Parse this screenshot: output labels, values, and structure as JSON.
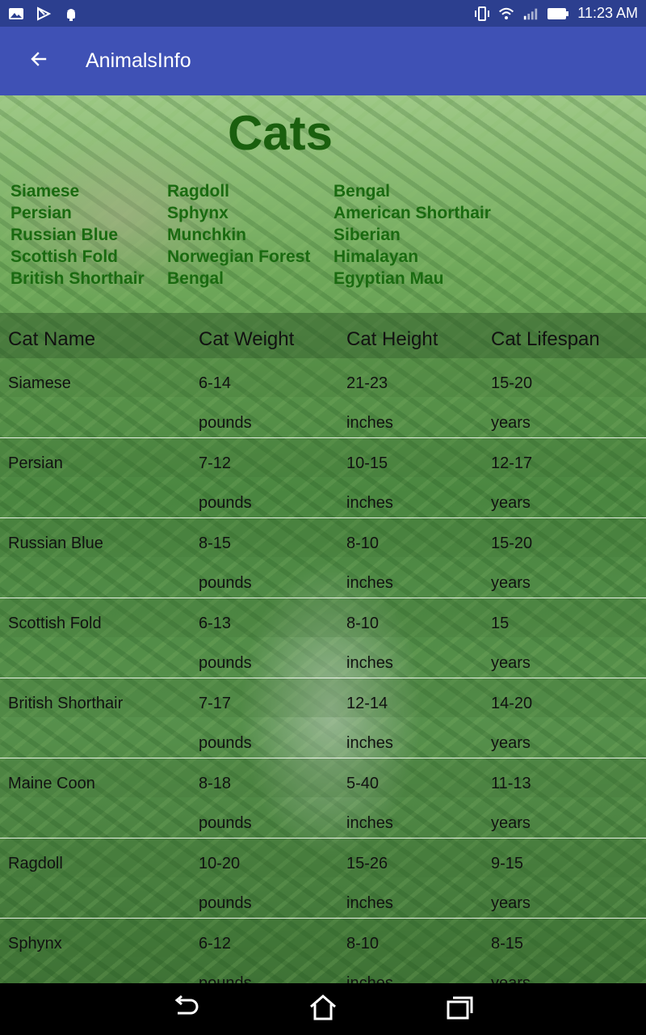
{
  "status_bar": {
    "time": "11:23 AM",
    "left_icons": [
      "gallery-icon",
      "play-store-icon",
      "android-debug-icon"
    ],
    "right_icons": [
      "vibrate-icon",
      "wifi-icon",
      "signal-icon",
      "battery-icon"
    ]
  },
  "app_bar": {
    "title": "AnimalsInfo",
    "back_icon": "arrow-left-icon"
  },
  "heading": "Cats",
  "breed_columns": [
    [
      "Siamese",
      "Persian",
      "Russian Blue",
      "Scottish Fold",
      "British Shorthair"
    ],
    [
      "Ragdoll",
      "Sphynx",
      "Munchkin",
      "Norwegian Forest",
      "Bengal"
    ],
    [
      "Bengal",
      "American Shorthair",
      "Siberian",
      "Himalayan",
      "Egyptian Mau"
    ]
  ],
  "table": {
    "headers": [
      "Cat Name",
      "Cat Weight",
      "Cat Height",
      "Cat Lifespan"
    ],
    "units": {
      "weight": "pounds",
      "height": "inches",
      "lifespan": "years"
    },
    "rows": [
      {
        "name": "Siamese",
        "weight": "6-14",
        "height": "21-23",
        "lifespan": "15-20"
      },
      {
        "name": "Persian",
        "weight": "7-12",
        "height": "10-15",
        "lifespan": "12-17"
      },
      {
        "name": "Russian Blue",
        "weight": "8-15",
        "height": "8-10",
        "lifespan": "15-20"
      },
      {
        "name": "Scottish Fold",
        "weight": "6-13",
        "height": "8-10",
        "lifespan": "15"
      },
      {
        "name": "British Shorthair",
        "weight": "7-17",
        "height": "12-14",
        "lifespan": "14-20"
      },
      {
        "name": "Maine Coon",
        "weight": "8-18",
        "height": "5-40",
        "lifespan": "11-13"
      },
      {
        "name": "Ragdoll",
        "weight": "10-20",
        "height": "15-26",
        "lifespan": "9-15"
      },
      {
        "name": "Sphynx",
        "weight": "6-12",
        "height": "8-10",
        "lifespan": "8-15"
      }
    ]
  },
  "nav_bar": {
    "icons": [
      "back-nav-icon",
      "home-icon",
      "recents-icon"
    ]
  },
  "colors": {
    "status_bar": "#2c3f8f",
    "app_bar": "#3f51b5",
    "heading": "#1a5f0e",
    "breed_text": "#1a6a10"
  }
}
